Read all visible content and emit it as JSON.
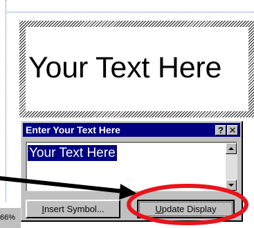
{
  "page": {
    "frame_text": "Your Text Here",
    "zoom_text": "66%"
  },
  "dialog": {
    "title": "Enter Your Text Here",
    "help_icon": "?",
    "close_icon": "✕",
    "text_value": "Your Text Here",
    "insert_prefix": "I",
    "insert_rest": "nsert Symbol...",
    "update_prefix": "U",
    "update_rest": "pdate Display"
  },
  "annotations": {
    "arrow_color": "#000000",
    "circle_color": "#e8141c"
  }
}
